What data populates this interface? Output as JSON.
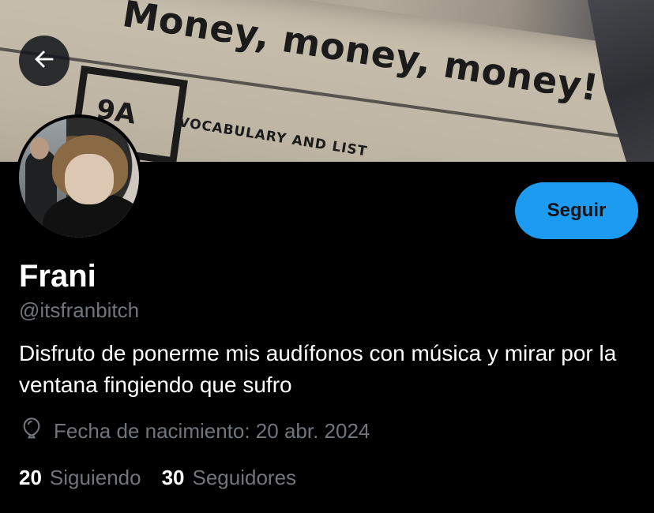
{
  "banner": {
    "headline": "Money, money, money!",
    "unit_code": "9A",
    "unit_subtitle": "VOCABULARY AND LIST"
  },
  "header": {
    "back_icon": "arrow-left-icon"
  },
  "profile": {
    "name": "Frani",
    "handle": "@itsfranbitch",
    "bio": "Disfruto de ponerme mis audífonos con música y mirar por la ventana fingiendo que sufro",
    "birth_icon": "balloon-icon",
    "birth": "Fecha de nacimiento: 20 abr. 2024",
    "follow_label": "Seguir",
    "accent_color": "#1d9bf0"
  },
  "stats": [
    {
      "count": "20",
      "label": "Siguiendo"
    },
    {
      "count": "30",
      "label": "Seguidores"
    }
  ]
}
